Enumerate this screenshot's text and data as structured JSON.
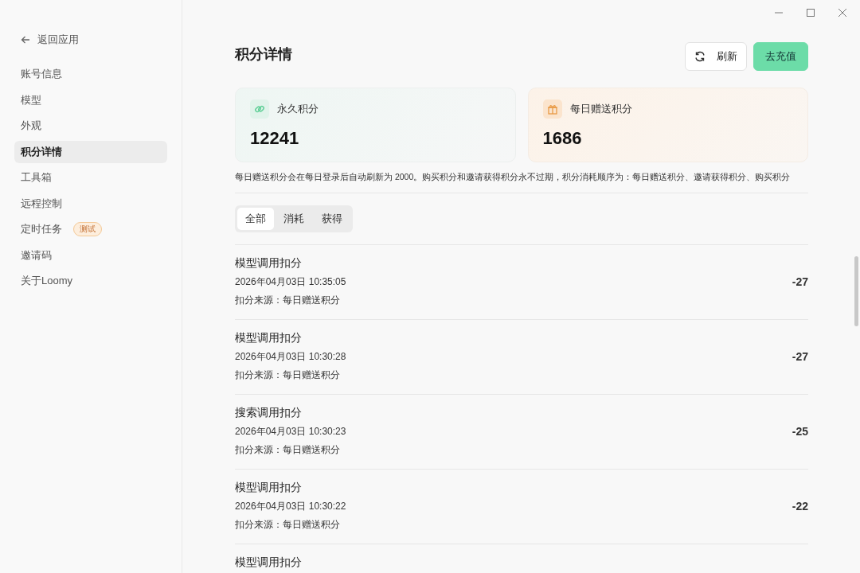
{
  "sidebar": {
    "back": "返回应用",
    "items": [
      {
        "label": "账号信息",
        "selected": false
      },
      {
        "label": "模型",
        "selected": false
      },
      {
        "label": "外观",
        "selected": false
      },
      {
        "label": "积分详情",
        "selected": true
      },
      {
        "label": "工具箱",
        "selected": false
      },
      {
        "label": "远程控制",
        "selected": false
      },
      {
        "label": "定时任务",
        "selected": false,
        "badge": "测试"
      },
      {
        "label": "邀请码",
        "selected": false
      },
      {
        "label": "关于Loomy",
        "selected": false
      }
    ]
  },
  "page": {
    "title": "积分详情",
    "refresh": "刷新",
    "recharge": "去充值"
  },
  "cards": [
    {
      "kind": "permanent",
      "label": "永久积分",
      "value": "12241"
    },
    {
      "kind": "daily",
      "label": "每日赠送积分",
      "value": "1686"
    }
  ],
  "note": "每日赠送积分会在每日登录后自动刷新为 2000。购买积分和邀请获得积分永不过期，积分消耗顺序为：每日赠送积分、邀请获得积分、购买积分",
  "filters": [
    {
      "label": "全部",
      "selected": true
    },
    {
      "label": "消耗",
      "selected": false
    },
    {
      "label": "获得",
      "selected": false
    }
  ],
  "records": [
    {
      "title": "模型调用扣分",
      "time": "2026年04月03日 10:35:05",
      "source": "扣分来源：每日赠送积分",
      "amount": "-27"
    },
    {
      "title": "模型调用扣分",
      "time": "2026年04月03日 10:30:28",
      "source": "扣分来源：每日赠送积分",
      "amount": "-27"
    },
    {
      "title": "搜索调用扣分",
      "time": "2026年04月03日 10:30:23",
      "source": "扣分来源：每日赠送积分",
      "amount": "-25"
    },
    {
      "title": "模型调用扣分",
      "time": "2026年04月03日 10:30:22",
      "source": "扣分来源：每日赠送积分",
      "amount": "-22"
    },
    {
      "title": "模型调用扣分"
    }
  ]
}
